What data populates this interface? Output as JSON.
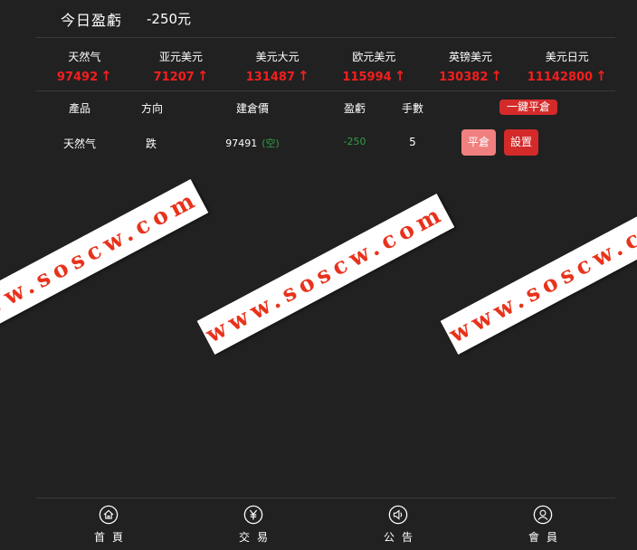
{
  "pl": {
    "title": "今日盈虧",
    "value": "-250元"
  },
  "quotes": [
    {
      "name": "天然气",
      "price": "97492"
    },
    {
      "name": "亚元美元",
      "price": "71207"
    },
    {
      "name": "美元大元",
      "price": "131487"
    },
    {
      "name": "欧元美元",
      "price": "115994"
    },
    {
      "name": "英镑美元",
      "price": "130382"
    },
    {
      "name": "美元日元",
      "price": "11142800"
    }
  ],
  "colors": {
    "up": "#f51e1e",
    "down": "#2ea043",
    "accent": "#d42a2a",
    "close_btn": "#f08080",
    "background": "#212121"
  },
  "table": {
    "headers": {
      "product": "產品",
      "direction": "方向",
      "open_price": "建倉價",
      "pnl": "盈虧",
      "lots": "手數"
    },
    "close_all_label": "一鍵平倉",
    "rows": [
      {
        "product": "天然气",
        "direction": "跌",
        "open_price": "97491",
        "side_tag": "(空)",
        "pnl": "-250",
        "lots": "5",
        "close_label": "平倉",
        "settings_label": "設置"
      }
    ]
  },
  "watermark": {
    "text": "www.soscw.com"
  },
  "tabs": [
    {
      "label": "首頁",
      "icon": "home-icon"
    },
    {
      "label": "交易",
      "icon": "yen-icon"
    },
    {
      "label": "公告",
      "icon": "speaker-icon"
    },
    {
      "label": "會員",
      "icon": "user-icon"
    }
  ]
}
